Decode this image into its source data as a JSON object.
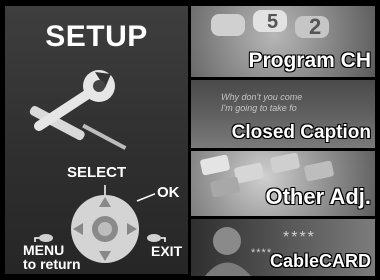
{
  "setup": {
    "title": "SETUP",
    "select_label": "SELECT",
    "ok_label": "OK",
    "menu_label_1": "MENU",
    "menu_label_2": "to return",
    "exit_label": "EXIT"
  },
  "menu_items": [
    {
      "label": "Program CH",
      "icon": "remote-keypad-image"
    },
    {
      "label": "Closed Caption",
      "icon": "caption-screen-image",
      "caption_text_1": "Why don't you come",
      "caption_text_2": "I'm going to take fo"
    },
    {
      "label": "Other Adj.",
      "icon": "keyboard-image"
    },
    {
      "label": "CableCARD",
      "icon": "cablecard-image",
      "stars": "****",
      "stars_small": "****"
    }
  ]
}
